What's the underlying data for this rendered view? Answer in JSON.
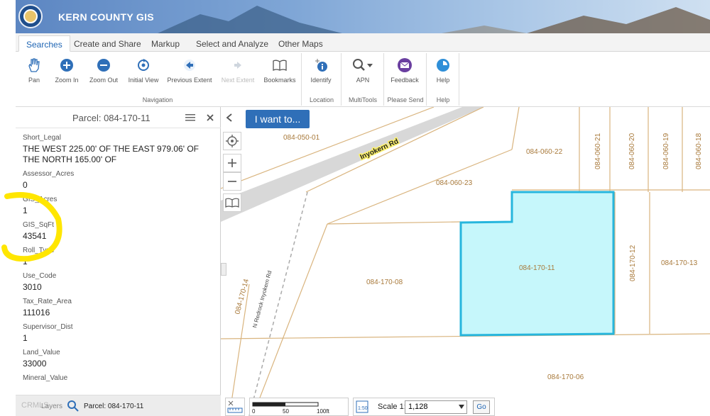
{
  "app": {
    "title": "KERN COUNTY GIS"
  },
  "tabs": [
    {
      "label": "Searches"
    },
    {
      "label": "Create and Share"
    },
    {
      "label": "Markup"
    },
    {
      "label": "Select and Analyze"
    },
    {
      "label": "Other Maps"
    }
  ],
  "ribbon": {
    "buttons": [
      {
        "label": "Pan",
        "icon": "hand-icon"
      },
      {
        "label": "Zoom In",
        "icon": "plus-circle-icon"
      },
      {
        "label": "Zoom Out",
        "icon": "minus-circle-icon"
      },
      {
        "label": "Initial View",
        "icon": "refresh-icon"
      },
      {
        "label": "Previous Extent",
        "icon": "arrow-left-icon"
      },
      {
        "label": "Next Extent",
        "icon": "arrow-right-icon"
      },
      {
        "label": "Bookmarks",
        "icon": "book-icon"
      },
      {
        "label": "Identify",
        "icon": "info-icon"
      },
      {
        "label": "APN",
        "icon": "magnifier-icon"
      },
      {
        "label": "Feedback",
        "icon": "mail-icon"
      },
      {
        "label": "Help",
        "icon": "help-icon"
      }
    ],
    "groups": [
      "Navigation",
      "Location",
      "MultiTools",
      "Please Send",
      "Help"
    ]
  },
  "panel": {
    "title": "Parcel: 084-170-11",
    "fields": [
      {
        "label": "Short_Legal",
        "value": "THE WEST 225.00' OF THE EAST 979.06' OF THE NORTH 165.00' OF"
      },
      {
        "label": "Assessor_Acres",
        "value": "0"
      },
      {
        "label": "GIS_Acres",
        "value": "1"
      },
      {
        "label": "GIS_SqFt",
        "value": "43541"
      },
      {
        "label": "Roll_Type",
        "value": "1"
      },
      {
        "label": "Use_Code",
        "value": "3010"
      },
      {
        "label": "Tax_Rate_Area",
        "value": "111016"
      },
      {
        "label": "Supervisor_Dist",
        "value": "1"
      },
      {
        "label": "Land_Value",
        "value": "33000"
      },
      {
        "label": "Mineral_Value",
        "value": ""
      }
    ],
    "footer": {
      "layers_label": "Layers",
      "result_label": "Parcel: 084-170-11"
    }
  },
  "map": {
    "want_button": "I want to...",
    "road_label": "Inyokern Rd",
    "side_road_label": "N Redrock Inyokern Rd",
    "parcels": [
      "084-050-01",
      "084-060-22",
      "084-060-21",
      "084-060-20",
      "084-060-19",
      "084-060-18",
      "084-060-23",
      "084-170-11",
      "084-170-12",
      "084-170-13",
      "084-170-08",
      "084-170-14",
      "084-170-06"
    ],
    "scalebar": {
      "ticks": [
        "0",
        "50",
        "100ft"
      ]
    },
    "scale": {
      "label": "Scale 1:",
      "value": "1,128",
      "go": "Go"
    },
    "highlight_color": "#c6f7fb",
    "highlight_stroke": "#27b6dd",
    "parcel_line_color": "#d9b47e",
    "parcel_label_color": "#a8793a"
  },
  "annotation": {
    "color": "#ffe600"
  },
  "watermark": "CRMLS"
}
